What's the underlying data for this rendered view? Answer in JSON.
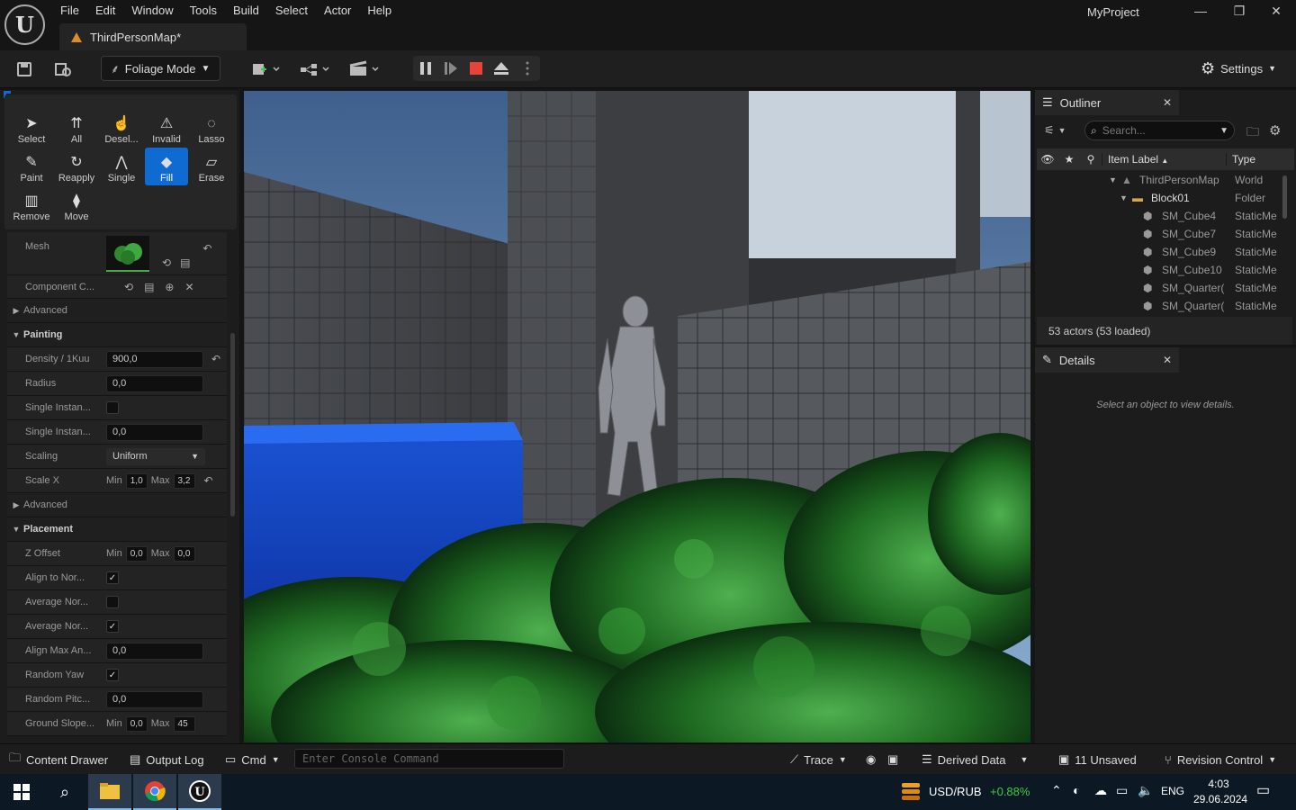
{
  "app": {
    "project_name": "MyProject",
    "level_tab": "ThirdPersonMap*",
    "logo": "unreal-engine-logo",
    "minimize": "—",
    "restore": "❐",
    "close": "✕"
  },
  "menu": [
    "File",
    "Edit",
    "Window",
    "Tools",
    "Build",
    "Select",
    "Actor",
    "Help"
  ],
  "toolbar": {
    "mode_label": "Foliage Mode",
    "settings_label": "Settings"
  },
  "foliage_tools": [
    {
      "label": "Select",
      "icon": "cursor-icon",
      "glyph": "➤"
    },
    {
      "label": "All",
      "icon": "select-all-icon",
      "glyph": "⇈"
    },
    {
      "label": "Desel...",
      "icon": "deselect-icon",
      "glyph": "☝"
    },
    {
      "label": "Invalid",
      "icon": "invalid-icon",
      "glyph": "⚠"
    },
    {
      "label": "Lasso",
      "icon": "lasso-icon",
      "glyph": "◌"
    },
    {
      "label": "Paint",
      "icon": "brush-icon",
      "glyph": "✎"
    },
    {
      "label": "Reapply",
      "icon": "reapply-icon",
      "glyph": "↻"
    },
    {
      "label": "Single",
      "icon": "single-icon",
      "glyph": "⋀"
    },
    {
      "label": "Fill",
      "icon": "bucket-icon",
      "glyph": "◆"
    },
    {
      "label": "Erase",
      "icon": "eraser-icon",
      "glyph": "▱"
    },
    {
      "label": "Remove",
      "icon": "trash-icon",
      "glyph": "🗑"
    },
    {
      "label": "Move",
      "icon": "move-icon",
      "glyph": "⧫"
    }
  ],
  "details_left": {
    "mesh_label": "Mesh",
    "component_label": "Component C...",
    "advanced_label": "Advanced",
    "painting_header": "Painting",
    "density_label": "Density / 1Kuu",
    "density_value": "900,0",
    "radius_label": "Radius",
    "radius_value": "0,0",
    "single_inst1_label": "Single Instan...",
    "single_inst2_label": "Single Instan...",
    "single_inst2_value": "0,0",
    "scaling_label": "Scaling",
    "scaling_value": "Uniform",
    "scalex_label": "Scale X",
    "min_label": "Min",
    "max_label": "Max",
    "scalex_min": "1,0",
    "scalex_max": "3,2",
    "advanced2_label": "Advanced",
    "placement_header": "Placement",
    "zoffset_label": "Z Offset",
    "zoffset_min": "0,0",
    "zoffset_max": "0,0",
    "align_normal_label": "Align to Nor...",
    "align_normal_checked": true,
    "avg_normal_label": "Average Nor...",
    "avg_normal_checked": false,
    "avg_normal2_label": "Average Nor...",
    "avg_normal2_checked": true,
    "align_max_label": "Align Max An...",
    "align_max_value": "0,0",
    "random_yaw_label": "Random Yaw",
    "random_yaw_checked": true,
    "random_pitch_label": "Random Pitc...",
    "random_pitch_value": "0,0",
    "ground_slope_label": "Ground Slope...",
    "ground_slope_min": "0,0",
    "ground_slope_max": "45"
  },
  "outliner": {
    "title": "Outliner",
    "search_placeholder": "Search...",
    "col_label": "Item Label",
    "col_type": "Type",
    "rows": [
      {
        "label": "ThirdPersonMap",
        "type": "World",
        "indent": 0,
        "icon": "world-icon"
      },
      {
        "label": "Block01",
        "type": "Folder",
        "indent": 1,
        "icon": "folder-icon"
      },
      {
        "label": "SM_Cube4",
        "type": "StaticMe",
        "indent": 2,
        "icon": "static-mesh-icon"
      },
      {
        "label": "SM_Cube7",
        "type": "StaticMe",
        "indent": 2,
        "icon": "static-mesh-icon"
      },
      {
        "label": "SM_Cube9",
        "type": "StaticMe",
        "indent": 2,
        "icon": "static-mesh-icon"
      },
      {
        "label": "SM_Cube10",
        "type": "StaticMe",
        "indent": 2,
        "icon": "static-mesh-icon"
      },
      {
        "label": "SM_Quarter(",
        "type": "StaticMe",
        "indent": 2,
        "icon": "static-mesh-icon"
      },
      {
        "label": "SM_Quarter(",
        "type": "StaticMe",
        "indent": 2,
        "icon": "static-mesh-icon"
      }
    ],
    "status": "53 actors (53 loaded)"
  },
  "details": {
    "title": "Details",
    "hint": "Select an object to view details."
  },
  "statusbar": {
    "content_drawer": "Content Drawer",
    "output_log": "Output Log",
    "cmd": "Cmd",
    "console_placeholder": "Enter Console Command",
    "trace": "Trace",
    "derived_data": "Derived Data",
    "unsaved": "11 Unsaved",
    "revision_control": "Revision Control"
  },
  "taskbar": {
    "ticker_symbol": "USD/RUB",
    "ticker_change": "+0.88%",
    "language": "ENG",
    "time": "4:03",
    "date": "29.06.2024"
  },
  "colors": {
    "accent": "#0f6ad1",
    "stop_red": "#e8433a",
    "ticker_green": "#3fc93f"
  }
}
